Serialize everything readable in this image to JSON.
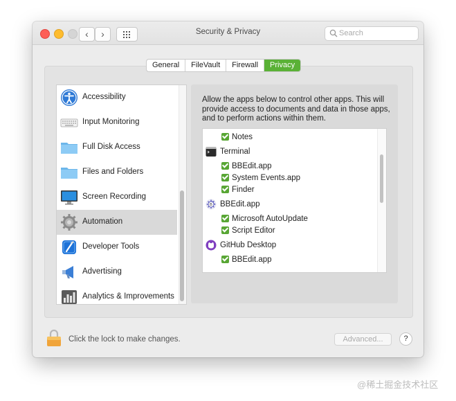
{
  "window": {
    "title": "Security & Privacy"
  },
  "toolbar": {
    "back_label": "‹",
    "forward_label": "›"
  },
  "search": {
    "placeholder": "Search"
  },
  "tabs": [
    {
      "label": "General",
      "active": false
    },
    {
      "label": "FileVault",
      "active": false
    },
    {
      "label": "Firewall",
      "active": false
    },
    {
      "label": "Privacy",
      "active": true
    }
  ],
  "sidebar": {
    "items": [
      {
        "label": "Accessibility",
        "icon": "accessibility-icon"
      },
      {
        "label": "Input Monitoring",
        "icon": "keyboard-icon"
      },
      {
        "label": "Full Disk Access",
        "icon": "folder-icon"
      },
      {
        "label": "Files and Folders",
        "icon": "folder-icon"
      },
      {
        "label": "Screen Recording",
        "icon": "display-icon"
      },
      {
        "label": "Automation",
        "icon": "gear-icon",
        "selected": true
      },
      {
        "label": "Developer Tools",
        "icon": "xcode-icon"
      },
      {
        "label": "Advertising",
        "icon": "megaphone-icon"
      },
      {
        "label": "Analytics & Improvements",
        "icon": "analytics-icon"
      }
    ]
  },
  "panel": {
    "description": "Allow the apps below to control other apps. This will provide access to documents and data in those apps, and to perform actions within them.",
    "apps": [
      {
        "type": "child",
        "label": "Notes",
        "checked": true
      },
      {
        "type": "parent",
        "label": "Terminal",
        "icon": "terminal-icon"
      },
      {
        "type": "child",
        "label": "BBEdit.app",
        "checked": true
      },
      {
        "type": "child",
        "label": "System Events.app",
        "checked": true
      },
      {
        "type": "child",
        "label": "Finder",
        "checked": true
      },
      {
        "type": "parent",
        "label": "BBEdit.app",
        "icon": "bbedit-icon"
      },
      {
        "type": "child",
        "label": "Microsoft AutoUpdate",
        "checked": true
      },
      {
        "type": "child",
        "label": "Script Editor",
        "checked": true
      },
      {
        "type": "parent",
        "label": "GitHub Desktop",
        "icon": "github-icon"
      },
      {
        "type": "child",
        "label": "BBEdit.app",
        "checked": true
      }
    ]
  },
  "footer": {
    "lock_text": "Click the lock to make changes.",
    "advanced_label": "Advanced...",
    "help_label": "?"
  },
  "watermark": "@稀土掘金技术社区"
}
